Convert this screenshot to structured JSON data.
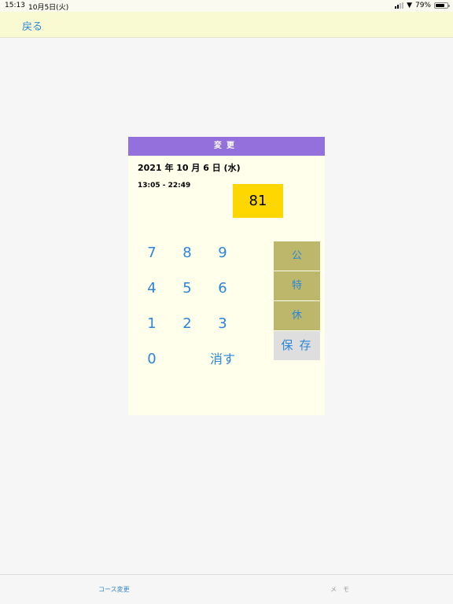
{
  "status_bar": {
    "time": "15:13",
    "date": "10月5日(火)",
    "battery": "79%",
    "battery_level": 0.79
  },
  "nav": {
    "back_label": "戻る"
  },
  "dialog": {
    "title": "変更",
    "date": "2021 年 10 月 6 日 (水)",
    "time_range": "13:05 - 22:49",
    "value": "81",
    "keypad": [
      "7",
      "8",
      "9",
      "4",
      "5",
      "6",
      "1",
      "2",
      "3",
      "0"
    ],
    "clear_label": "消す",
    "side_buttons": [
      "公",
      "特",
      "休"
    ],
    "save_label": "保存"
  },
  "tabs": {
    "course_change": "コース変更",
    "memo": "メモ"
  },
  "colors": {
    "header": "#9370db",
    "value_box": "#ffd700",
    "side_button": "#bdb76b",
    "link": "#2b86d9"
  }
}
